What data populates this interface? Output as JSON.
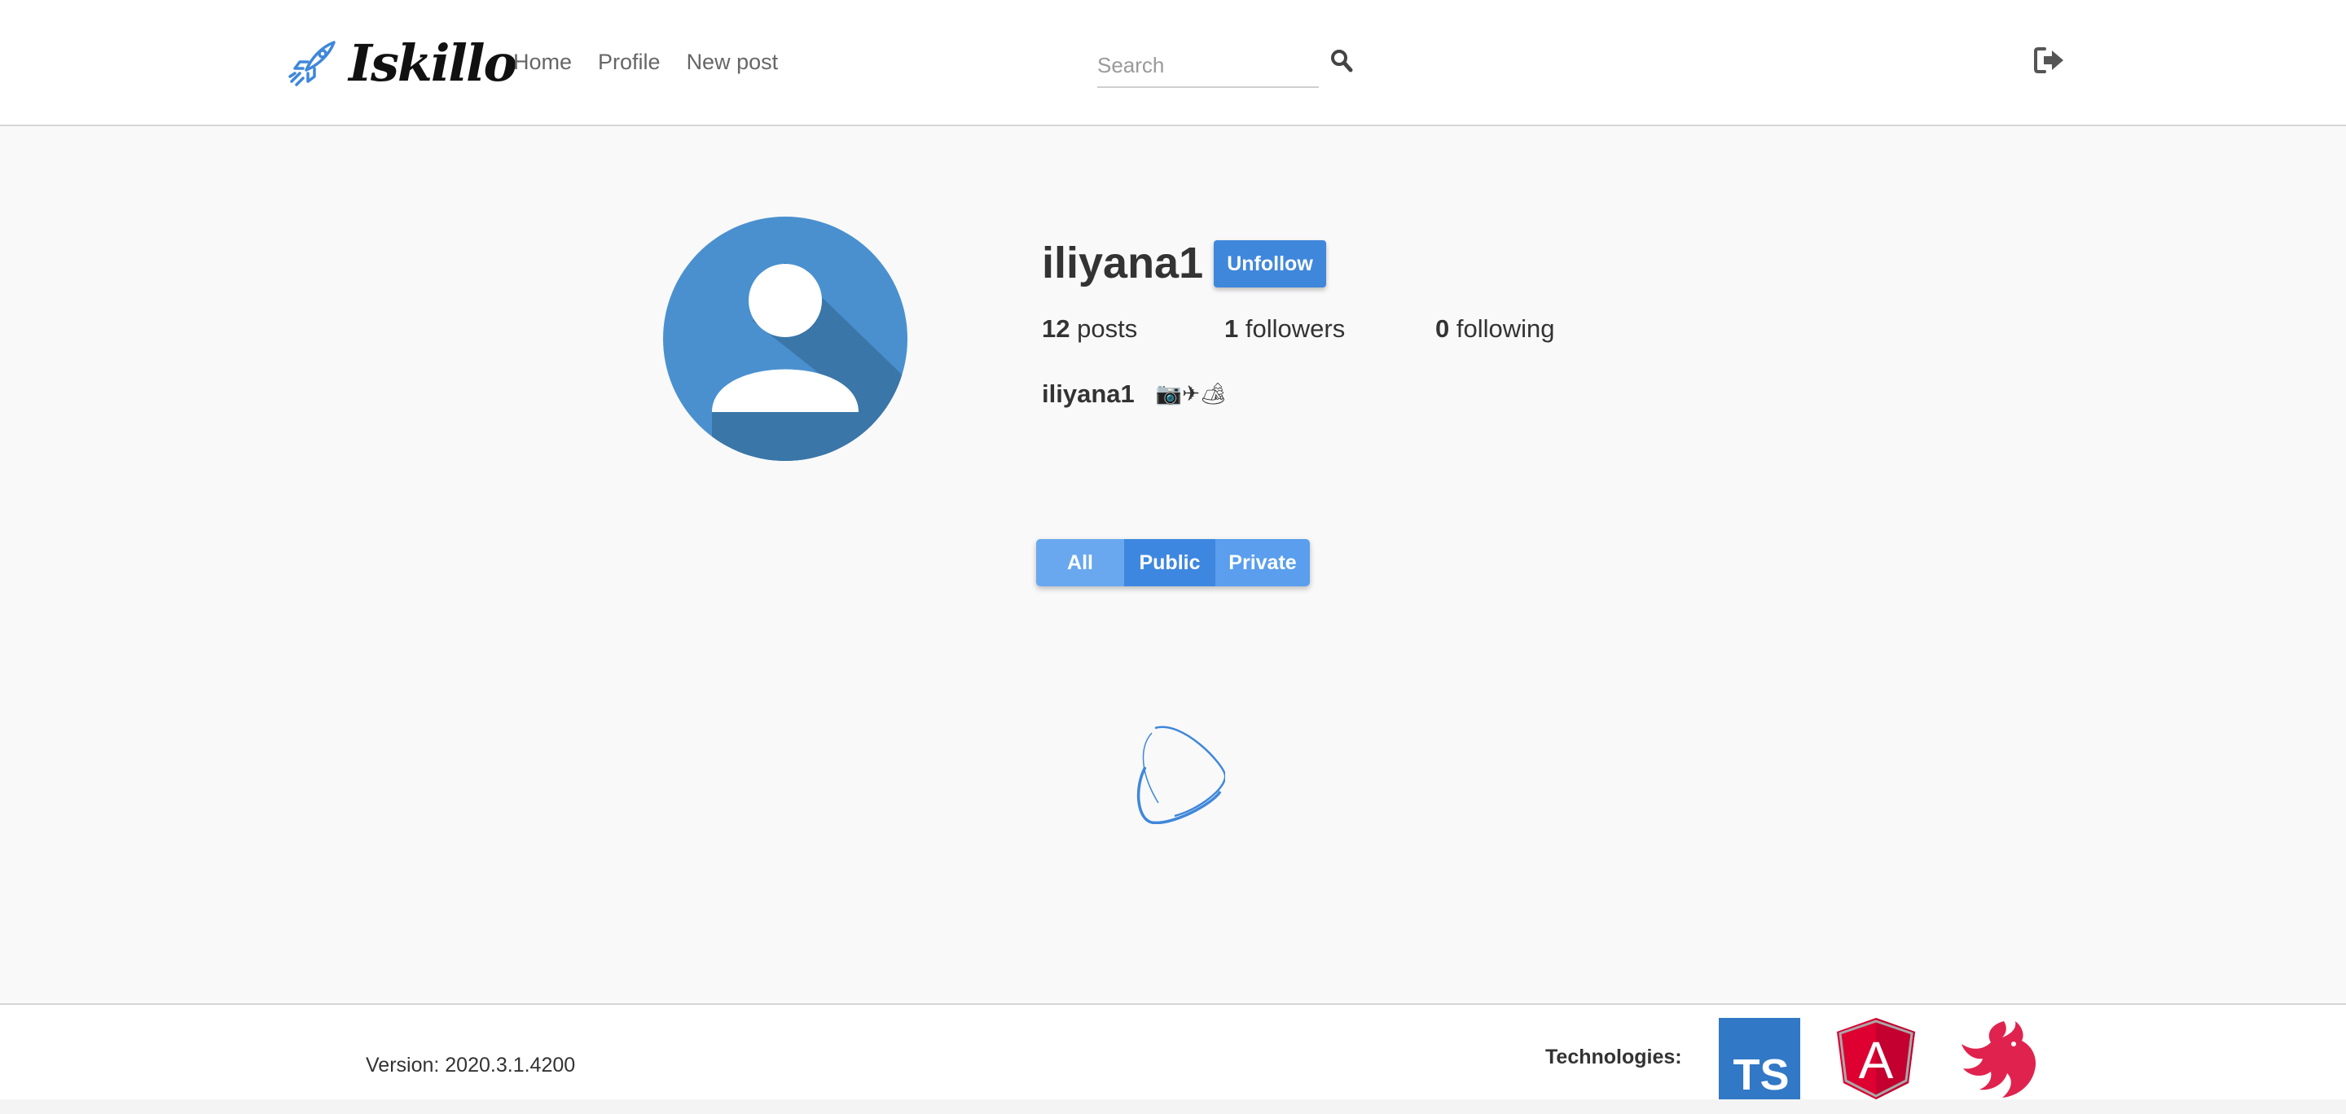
{
  "header": {
    "brand": {
      "name": "Iskillo",
      "icon": "rocket-icon"
    },
    "nav": [
      {
        "label": "Home"
      },
      {
        "label": "Profile"
      },
      {
        "label": "New post"
      }
    ],
    "search": {
      "placeholder": "Search",
      "value": "",
      "icon": "search-icon"
    },
    "logout_icon": "sign-out-icon"
  },
  "profile": {
    "username": "iliyana1",
    "follow_button_label": "Unfollow",
    "stats": {
      "posts_count": "12",
      "posts_label": "posts",
      "followers_count": "1",
      "followers_label": "followers",
      "following_count": "0",
      "following_label": "following"
    },
    "bio": {
      "name": "iliyana1",
      "text": "📷✈🏕"
    }
  },
  "filters": [
    {
      "label": "All"
    },
    {
      "label": "Public"
    },
    {
      "label": "Private"
    }
  ],
  "footer": {
    "version": "Version: 2020.3.1.4200",
    "technologies_label": "Technologies:",
    "technologies": [
      {
        "name": "TypeScript",
        "badge_text": "TS",
        "icon": "typescript-logo-icon"
      },
      {
        "name": "Angular",
        "badge_text": "A",
        "icon": "angular-logo-icon"
      },
      {
        "name": "NestJS",
        "icon": "nestjs-logo-icon"
      }
    ]
  },
  "colors": {
    "accent": "#3f87db",
    "avatar_bg": "#4a90cf",
    "avatar_shadow": "#3a76a8",
    "page_bg": "#f9f9f9",
    "typescript": "#3178c6",
    "angular": "#dd0031",
    "nestjs": "#e0234e"
  }
}
